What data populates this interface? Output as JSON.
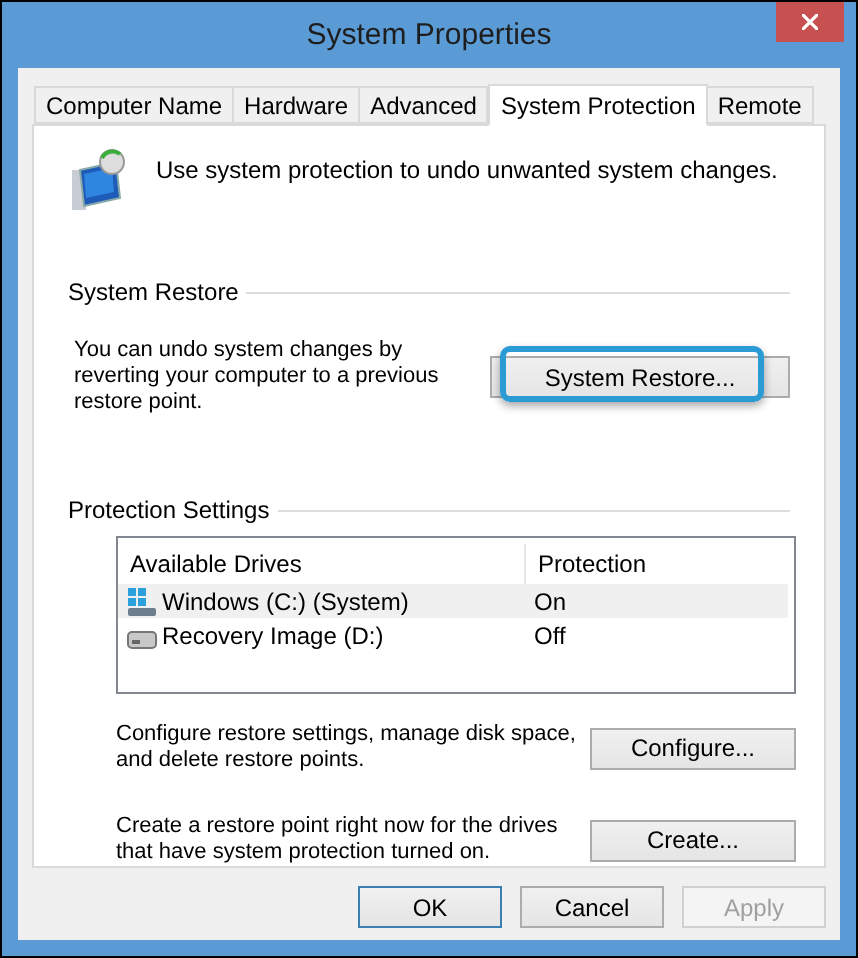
{
  "window": {
    "title": "System Properties"
  },
  "tabs": [
    {
      "label": "Computer Name",
      "selected": false
    },
    {
      "label": "Hardware",
      "selected": false
    },
    {
      "label": "Advanced",
      "selected": false
    },
    {
      "label": "System Protection",
      "selected": true
    },
    {
      "label": "Remote",
      "selected": false
    }
  ],
  "intro": "Use system protection to undo unwanted system changes.",
  "system_restore": {
    "heading": "System Restore",
    "text": "You can undo system changes by reverting your computer to a previous restore point.",
    "button": "System Restore...",
    "highlighted": true
  },
  "protection_settings": {
    "heading": "Protection Settings",
    "columns": [
      "Available Drives",
      "Protection"
    ],
    "rows": [
      {
        "kind": "system",
        "drive": "Windows (C:) (System)",
        "protection": "On",
        "selected": true
      },
      {
        "kind": "plain",
        "drive": "Recovery Image (D:)",
        "protection": "Off",
        "selected": false
      }
    ],
    "configure": {
      "text": "Configure restore settings, manage disk space, and delete restore points.",
      "button": "Configure..."
    },
    "create": {
      "text": "Create a restore point right now for the drives that have system protection turned on.",
      "button": "Create..."
    }
  },
  "buttons": [
    {
      "label": "OK",
      "default": true,
      "disabled": false
    },
    {
      "label": "Cancel",
      "default": false,
      "disabled": false
    },
    {
      "label": "Apply",
      "default": false,
      "disabled": true
    }
  ]
}
